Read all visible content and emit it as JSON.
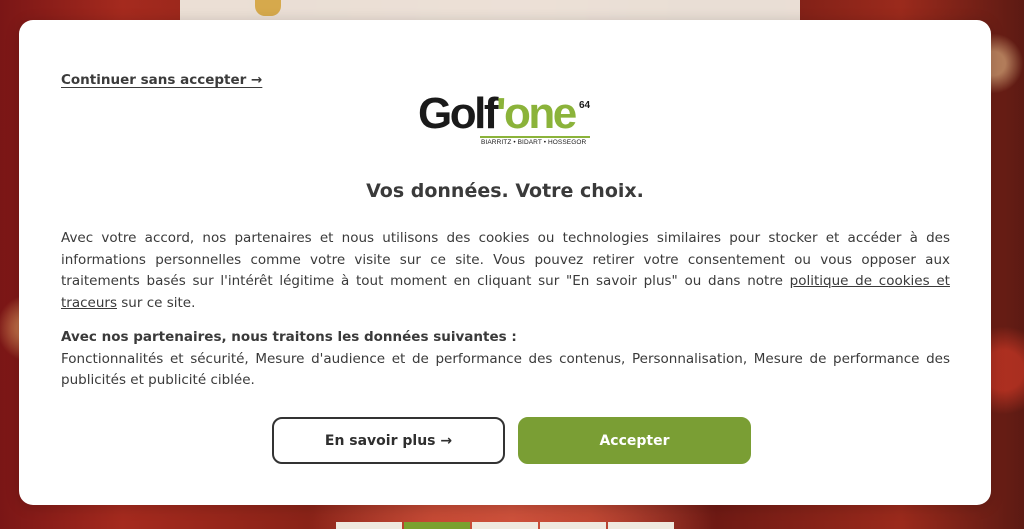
{
  "colors": {
    "brand_green": "#8bb33a",
    "accept_button": "#7a9e34",
    "text": "#3a3a3a",
    "modal_bg": "#ffffff"
  },
  "consent": {
    "skip_link": "Continuer sans accepter →",
    "logo": {
      "brand_dark": "Golf",
      "brand_green": "'one",
      "superscript": "64",
      "locations": "BIARRITZ • BIDART • HOSSEGOR"
    },
    "title": "Vos données. Votre choix.",
    "body_before_link": "Avec votre accord, nos partenaires et nous utilisons des cookies ou technologies similaires pour stocker et accéder à des informations personnelles comme votre visite sur ce site. Vous pouvez retirer votre consentement ou vous opposer aux traitements basés sur l'intérêt légitime à tout moment en cliquant sur \"En savoir plus\" ou dans notre ",
    "policy_link": "politique de cookies et traceurs",
    "body_after_link": " sur ce site.",
    "purposes_heading": "Avec nos partenaires, nous traitons les données suivantes :",
    "purposes_list": "Fonctionnalités et sécurité, Mesure d'audience et de performance des contenus, Personnalisation, Mesure de performance des publicités et publicité ciblée.",
    "learn_more_button": "En savoir plus →",
    "accept_button": "Accepter"
  }
}
